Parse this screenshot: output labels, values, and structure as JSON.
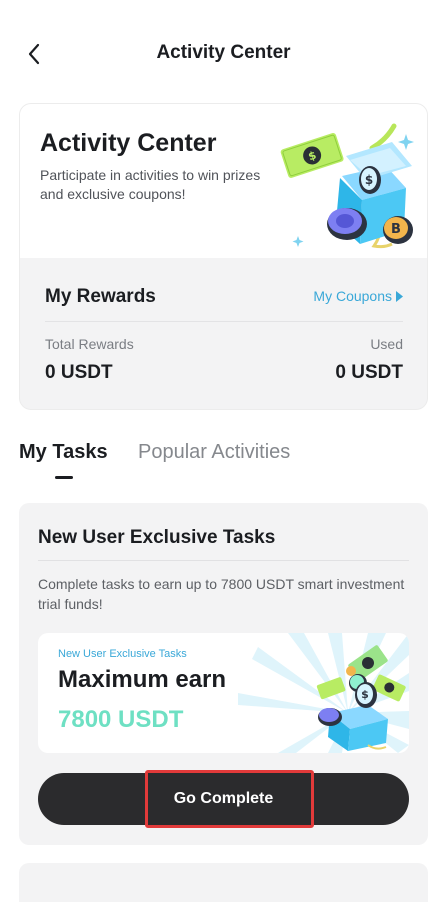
{
  "header": {
    "title": "Activity Center",
    "back_icon": "chevron-left-icon"
  },
  "hero": {
    "title": "Activity Center",
    "description": "Participate in activities to win prizes and exclusive coupons!"
  },
  "rewards": {
    "heading": "My Rewards",
    "coupons_link": "My Coupons",
    "total_label": "Total Rewards",
    "total_value": "0 USDT",
    "used_label": "Used",
    "used_value": "0 USDT"
  },
  "tabs": [
    {
      "label": "My Tasks",
      "active": true
    },
    {
      "label": "Popular Activities",
      "active": false
    }
  ],
  "task_card": {
    "title": "New User Exclusive Tasks",
    "description": "Complete tasks to earn up to 7800 USDT smart investment trial funds!",
    "banner": {
      "tag": "New User Exclusive Tasks",
      "headline": "Maximum earn",
      "amount": "7800 USDT"
    },
    "button_label": "Go Complete"
  },
  "colors": {
    "accent_blue": "#3aa8d8",
    "amount_mint": "#6ee0c3",
    "button_dark": "#2b2b2d",
    "highlight_red": "#e23a3a"
  }
}
